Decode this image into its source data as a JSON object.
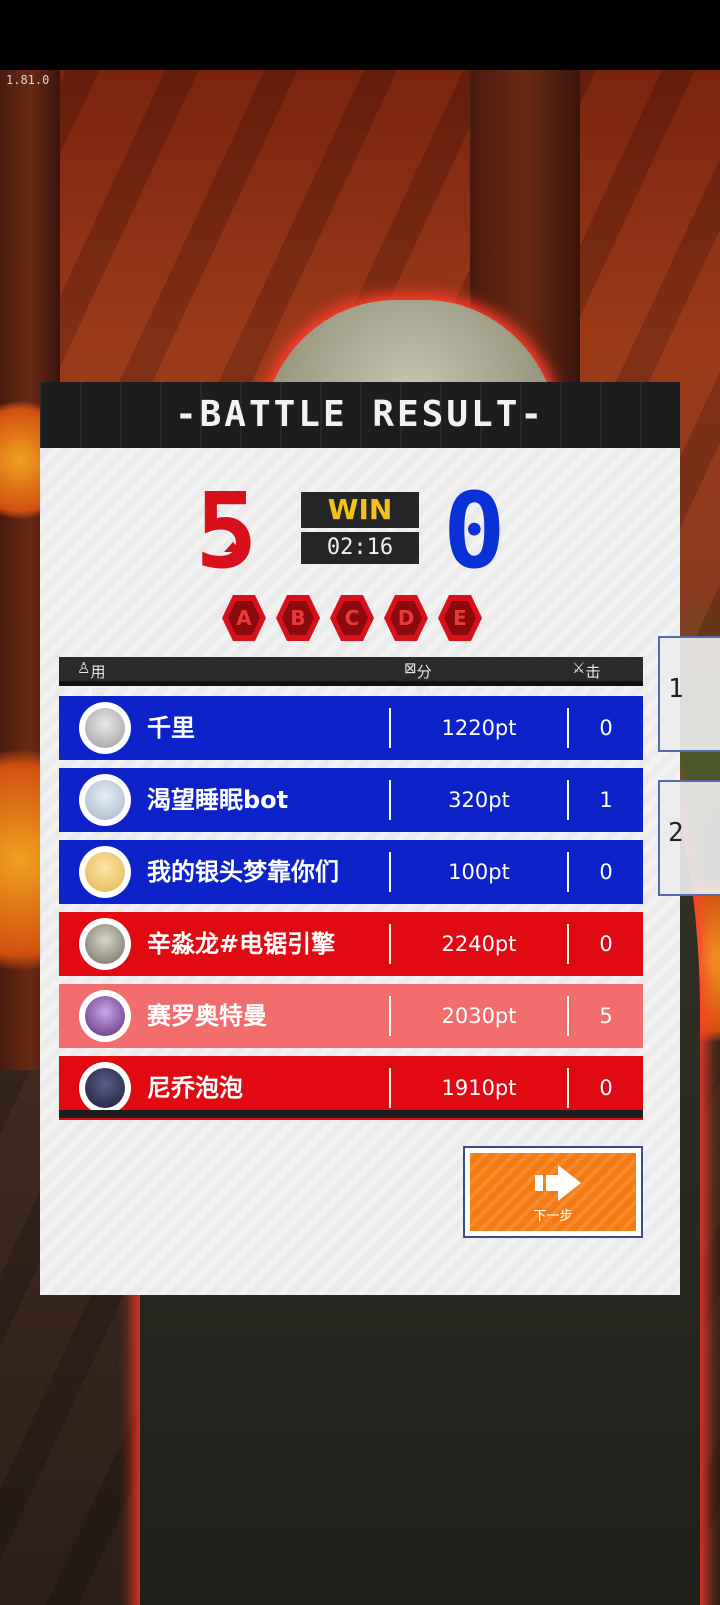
{
  "version": "1.81.0",
  "panel": {
    "title": "-BATTLE RESULT-"
  },
  "match": {
    "red_score": "5",
    "blue_score": "0",
    "result": "WIN",
    "time": "02:16"
  },
  "zones": [
    "A",
    "B",
    "C",
    "D",
    "E"
  ],
  "table": {
    "col_user": "用户名",
    "col_score": "分数",
    "col_kills": "击杀"
  },
  "players": [
    {
      "name": "千里",
      "points": "1220pt",
      "kills": "0",
      "team": "blue"
    },
    {
      "name": "渴望睡眠bot",
      "points": "320pt",
      "kills": "1",
      "team": "blue"
    },
    {
      "name": "我的银头梦靠你们",
      "points": "100pt",
      "kills": "0",
      "team": "blue"
    },
    {
      "name": "辛淼龙#电锯引擎",
      "points": "2240pt",
      "kills": "0",
      "team": "red"
    },
    {
      "name": "赛罗奥特曼",
      "points": "2030pt",
      "kills": "5",
      "team": "red"
    },
    {
      "name": "尼乔泡泡",
      "points": "1910pt",
      "kills": "0",
      "team": "red"
    }
  ],
  "next_button": {
    "label": "下一步"
  },
  "side_tabs": [
    "1",
    "2"
  ],
  "colors": {
    "red_team": "#e20a12",
    "blue_team": "#0d22c8",
    "highlight_row": "#f26d6d",
    "win": "#f4c21c",
    "next_button": "#f57a12"
  }
}
